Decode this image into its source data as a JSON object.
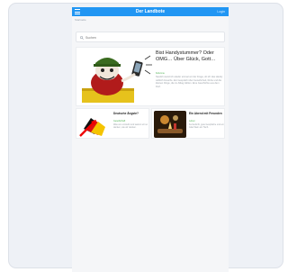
{
  "app": {
    "title": "Der Landbote",
    "login_label": "Login"
  },
  "breadcrumb": "Startseite",
  "search": {
    "placeholder": "Suchen",
    "value": ""
  },
  "featured": {
    "title": "Bist Handystummer? Oder OMG… Über Glück, Gott…",
    "meta": "Kolumne",
    "excerpt": "Neulich stand ich wieder einmal vor der Frage, ob ich das Handy wirklich brauche. Ein Gespräch über Gewohnheit, Ruhe und die kleinen Dinge, die im Alltag zählen. Eine Geschichte aus dem Dorf."
  },
  "cards": [
    {
      "title": "Deutsche Ängste?",
      "meta": "Gesellschaft",
      "text": "Was uns umtreibt und warum wir so denken, wie wir denken."
    },
    {
      "title": "Ein Abend mit Freunden",
      "meta": "Leben",
      "text": "Kerzenlicht, gute Gespräche und ein Glas Wein am Tisch."
    }
  ],
  "colors": {
    "primary": "#2196f3",
    "accent": "#4caf50",
    "background": "#f5f6f8"
  }
}
